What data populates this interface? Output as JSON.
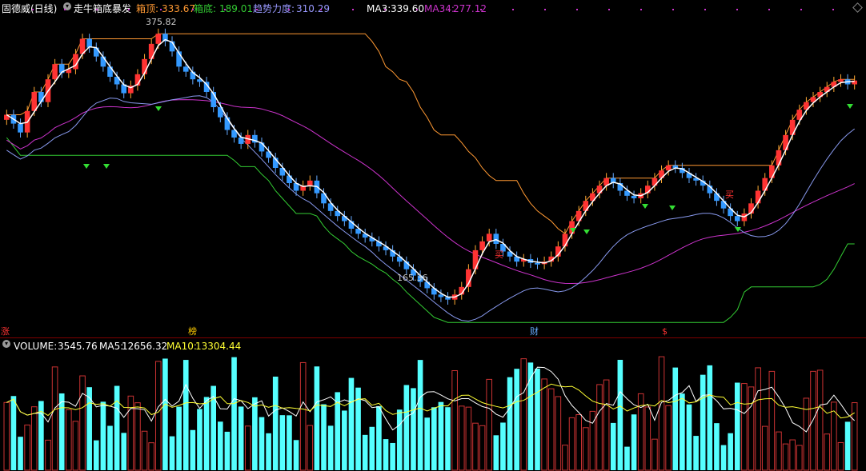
{
  "header": {
    "title": "固德威(日线)",
    "indicator": "走牛箱底暴发",
    "box_top_label": "箱顶:",
    "box_top_value": "333.67",
    "box_bottom_label": "箱底:",
    "box_bottom_value": "189.01",
    "trend_label": "趋势力度:",
    "trend_value": "310.29",
    "ma3_label": "MA3:",
    "ma3_value": "339.60",
    "ma34_label": "MA34:",
    "ma34_value": "277.12"
  },
  "price_annotations": {
    "high": "375.82",
    "low": "165.36"
  },
  "buy_label": "买",
  "event_marks": [
    {
      "text": "涨",
      "color": "#ff3333"
    },
    {
      "text": "榜",
      "color": "#ffcc00"
    },
    {
      "text": "财",
      "color": "#66aaff"
    },
    {
      "text": "$",
      "color": "#ff3333"
    }
  ],
  "volume_header": {
    "label": "VOLUME:",
    "value": "3545.76",
    "ma5_label": "MA5:",
    "ma5_value": "12656.32",
    "ma10_label": "MA10:",
    "ma10_value": "13304.44"
  },
  "colors": {
    "up_candle": "#ff3333",
    "down_candle": "#3399ff",
    "volume_up": "#cc3333",
    "volume_down": "#55ffff",
    "box_top": "#ff9933",
    "box_bottom": "#33cc33",
    "ma34": "#cc33cc",
    "band": "#8899ee",
    "ma3": "#ffffff"
  },
  "chart_data": {
    "type": "candlestick",
    "price_closes": [
      312,
      305,
      298,
      315,
      330,
      322,
      340,
      352,
      345,
      348,
      360,
      372,
      365,
      358,
      350,
      342,
      336,
      329,
      335,
      344,
      356,
      368,
      376,
      370,
      362,
      350,
      346,
      340,
      338,
      330,
      318,
      310,
      300,
      294,
      289,
      296,
      290,
      283,
      278,
      270,
      264,
      258,
      252,
      256,
      260,
      250,
      242,
      236,
      232,
      228,
      222,
      218,
      215,
      212,
      208,
      205,
      200,
      196,
      190,
      185,
      180,
      175,
      170,
      168,
      166,
      170,
      176,
      190,
      205,
      212,
      218,
      210,
      204,
      200,
      196,
      198,
      195,
      194,
      196,
      200,
      208,
      218,
      228,
      236,
      244,
      250,
      256,
      262,
      258,
      252,
      248,
      246,
      250,
      256,
      262,
      268,
      272,
      270,
      266,
      262,
      260,
      256,
      250,
      244,
      238,
      232,
      228,
      234,
      242,
      252,
      262,
      272,
      284,
      296,
      308,
      316,
      322,
      326,
      330,
      334,
      338,
      340,
      336,
      339
    ]
  }
}
